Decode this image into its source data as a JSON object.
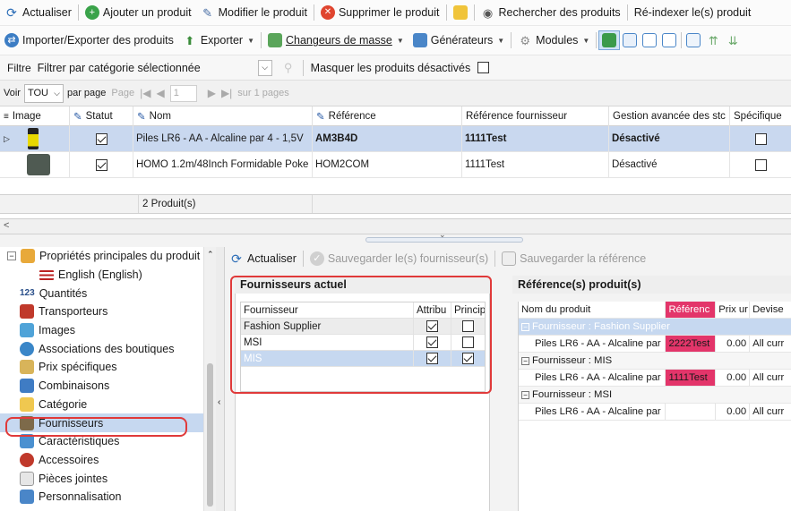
{
  "toolbar1": {
    "refresh": "Actualiser",
    "add_product": "Ajouter un produit",
    "edit_product": "Modifier le produit",
    "delete_product": "Supprimer le produit",
    "search_products": "Rechercher des produits",
    "reindex": "Ré-indexer le(s) produit"
  },
  "toolbar2": {
    "import_export": "Importer/Exporter des produits",
    "export": "Exporter",
    "mass_changers": "Changeurs de masse",
    "generators": "Générateurs",
    "modules": "Modules"
  },
  "filter": {
    "label": "Filtre",
    "value": "Filtrer par catégorie sélectionnée",
    "hide_disabled": "Masquer les produits désactivés"
  },
  "pager": {
    "show": "Voir",
    "per_page_value": "TOU",
    "per_page": "par page",
    "page": "Page",
    "page_value": "1",
    "of_pages": "sur 1 pages"
  },
  "grid": {
    "columns": [
      "Image",
      "Statut",
      "Nom",
      "Référence",
      "Référence fournisseur",
      "Gestion avancée des stc",
      "Spécifique"
    ],
    "rows": [
      {
        "name": "Piles LR6 - AA - Alcaline par 4 - 1,5V",
        "reference": "AM3B4D",
        "supplier_ref": "1111Test",
        "advanced_stock": "Désactivé",
        "status": true,
        "specific": false
      },
      {
        "name": "HOMO 1.2m/48Inch Formidable Poke",
        "reference": "HOM2COM",
        "supplier_ref": "1111Test",
        "advanced_stock": "Désactivé",
        "status": true,
        "specific": false
      }
    ],
    "count": "2 Produit(s)"
  },
  "tree": {
    "root": "Propriétés principales du produit",
    "items": [
      "English (English)",
      "Quantités",
      "Transporteurs",
      "Images",
      "Associations des boutiques",
      "Prix spécifiques",
      "Combinaisons",
      "Catégorie",
      "Fournisseurs",
      "Caractéristiques",
      "Accessoires",
      "Pièces jointes",
      "Personnalisation"
    ],
    "qty_prefix": "123"
  },
  "right_toolbar": {
    "refresh": "Actualiser",
    "save_suppliers": "Sauvegarder le(s) fournisseur(s)",
    "save_reference": "Sauvegarder la référence"
  },
  "suppliers": {
    "title": "Fournisseurs actuel",
    "columns": [
      "Fournisseur",
      "Attribu",
      "Princip"
    ],
    "rows": [
      {
        "name": "Fashion Supplier",
        "attributed": true,
        "principal": false
      },
      {
        "name": "MSI",
        "attributed": true,
        "principal": false
      },
      {
        "name": "MIS",
        "attributed": true,
        "principal": true
      }
    ]
  },
  "product_refs": {
    "title": "Référence(s) produit(s)",
    "columns": [
      "Nom du produit",
      "Référenc",
      "Prix ur",
      "Devise"
    ],
    "groups": [
      {
        "label": "Fournisseur : Fashion Supplier",
        "product": "Piles LR6 - AA - Alcaline par",
        "reference": "2222Test",
        "price": "0.00",
        "currency": "All curr"
      },
      {
        "label": "Fournisseur : MIS",
        "product": "Piles LR6 - AA - Alcaline par",
        "reference": "1111Test",
        "price": "0.00",
        "currency": "All curr"
      },
      {
        "label": "Fournisseur : MSI",
        "product": "Piles LR6 - AA - Alcaline par",
        "reference": "",
        "price": "0.00",
        "currency": "All curr"
      }
    ]
  }
}
